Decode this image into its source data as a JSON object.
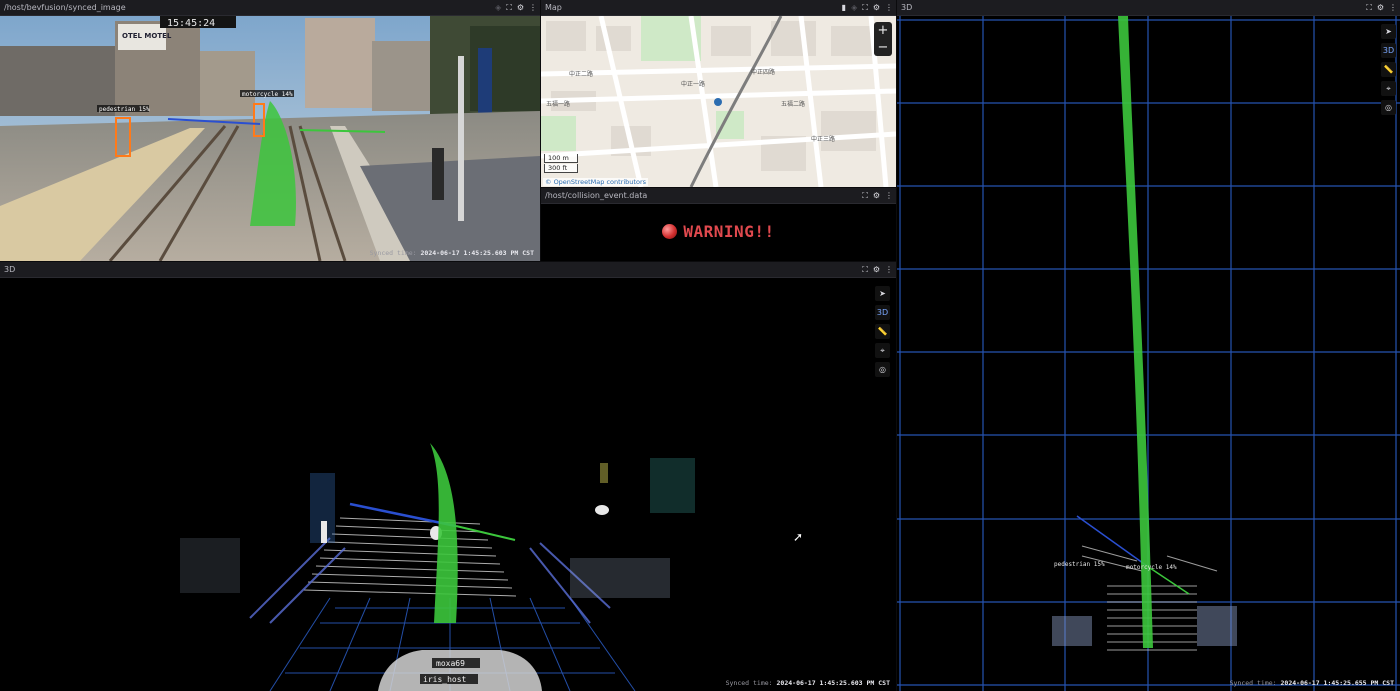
{
  "image_panel": {
    "title": "/host/bevfusion/synced_image",
    "overlay_clock": "15:45:24",
    "sign_text": "OTEL MOTEL",
    "label_pedestrian": "pedestrian 15%",
    "label_motorcycle": "motorcycle 14%",
    "synced_label": "Synced time:",
    "synced_value": "2024-06-17 1:45:25.603 PM CST"
  },
  "map_panel": {
    "title": "Map",
    "zoom_in": "+",
    "zoom_out": "−",
    "scale_m": "100 m",
    "scale_ft": "300 ft",
    "attribution_link": "© OpenStreetMap",
    "attribution_rest": " contributors",
    "street_labels": [
      "中正二路",
      "中正一路",
      "五福一路",
      "五福二路",
      "中正四路",
      "中正三路"
    ]
  },
  "warning_panel": {
    "title": "/host/collision_event.data",
    "message": "WARNING!!"
  },
  "scene_left": {
    "title": "3D",
    "tool_3d": "3D",
    "host_top": "moxa69",
    "host_bottom": "iris_host",
    "synced_label": "Synced time:",
    "synced_value": "2024-06-17 1:45:25.603 PM CST"
  },
  "scene_right": {
    "title": "3D",
    "tool_3d": "3D",
    "label_pedestrian": "pedestrian 15%",
    "label_motorcycle": "motorcycle 14%",
    "synced_label": "Synced time:",
    "synced_value": "2024-06-17 1:45:25.655 PM CST"
  },
  "icons": {
    "header": [
      "sync-icon",
      "fullscreen-icon",
      "gear-icon",
      "more-icon"
    ],
    "toolbar": [
      "select-pointer-icon",
      "3d-toggle",
      "ruler-icon",
      "publish-point-icon",
      "follow-camera-icon"
    ]
  },
  "colors": {
    "path_green": "#3cc63c",
    "grid_blue": "#2a5cc4",
    "warning_red": "#e0494e",
    "panel_header": "#1c1c20"
  }
}
